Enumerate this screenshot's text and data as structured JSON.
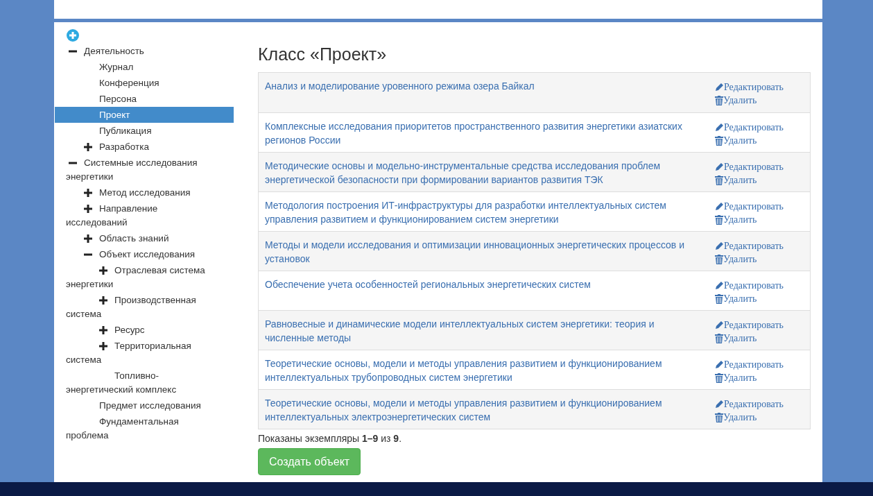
{
  "tree": {
    "items": [
      {
        "label": "Деятельность",
        "expanded": true,
        "selected": false,
        "children": [
          {
            "label": "Журнал",
            "selected": false
          },
          {
            "label": "Конференция",
            "selected": false
          },
          {
            "label": "Персона",
            "selected": false
          },
          {
            "label": "Проект",
            "selected": true
          },
          {
            "label": "Публикация",
            "selected": false
          },
          {
            "label": "Разработка",
            "expanded": false,
            "selected": false
          }
        ]
      },
      {
        "label": "Системные исследования энергетики",
        "expanded": true,
        "selected": false,
        "children": [
          {
            "label": "Метод исследования",
            "expanded": false,
            "selected": false
          },
          {
            "label": "Направление исследований",
            "expanded": false,
            "selected": false
          },
          {
            "label": "Область знаний",
            "expanded": false,
            "selected": false
          },
          {
            "label": "Объект исследования",
            "expanded": true,
            "selected": false,
            "children": [
              {
                "label": "Отраслевая система энергетики",
                "expanded": false,
                "selected": false
              },
              {
                "label": "Производственная система",
                "expanded": false,
                "selected": false
              },
              {
                "label": "Ресурс",
                "expanded": false,
                "selected": false
              },
              {
                "label": "Территориальная система",
                "expanded": false,
                "selected": false
              },
              {
                "label": "Топливно-энергетический комплекс",
                "selected": false
              }
            ]
          },
          {
            "label": "Предмет исследования",
            "selected": false
          },
          {
            "label": "Фундаментальная проблема",
            "selected": false
          }
        ]
      }
    ]
  },
  "title": "Класс «Проект»",
  "table": {
    "rows": [
      {
        "title": "Анализ и моделирование уровенного режима озера Байкал",
        "edit": "Редактировать",
        "delete": "Удалить"
      },
      {
        "title": "Комплексные исследования приоритетов пространственного развития энергетики азиатских регионов России",
        "edit": "Редактировать",
        "delete": "Удалить"
      },
      {
        "title": "Методические основы и модельно-инструментальные средства исследования проблем энергетической безопасности при формировании вариантов развития ТЭК",
        "edit": "Редактировать",
        "delete": "Удалить"
      },
      {
        "title": "Методология построения ИТ-инфраструктуры для разработки интеллектуальных систем управления развитием и функционированием систем энергетики",
        "edit": "Редактировать",
        "delete": "Удалить"
      },
      {
        "title": "Методы и модели исследования и оптимизации инновационных энергетических процессов и установок",
        "edit": "Редактировать",
        "delete": "Удалить"
      },
      {
        "title": "Обеспечение учета особенностей региональных энергетических систем",
        "edit": "Редактировать",
        "delete": "Удалить"
      },
      {
        "title": "Равновесные и динамические модели интеллектуальных систем энергетики: теория и численные методы",
        "edit": "Редактировать",
        "delete": "Удалить"
      },
      {
        "title": "Теоретические основы, модели и методы управления развитием и функционированием интеллектуальных трубопроводных систем энергетики",
        "edit": "Редактировать",
        "delete": "Удалить"
      },
      {
        "title": "Теоретические основы, модели и методы управления развитием и функционированием интеллектуальных электроэнергетических систем",
        "edit": "Редактировать",
        "delete": "Удалить"
      }
    ]
  },
  "summary": "Показаны экземпляры **1–9** из **9**.",
  "create_button": "Создать объект"
}
